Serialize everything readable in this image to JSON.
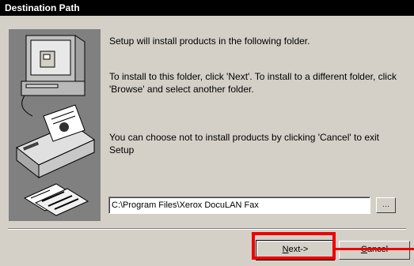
{
  "window": {
    "title": "Destination Path"
  },
  "messages": {
    "line1": "Setup will install products in the following folder.",
    "line2": "To install to this folder, click 'Next'. To install to a different folder, click 'Browse' and select another folder.",
    "line3": "You can choose not to install products by clicking 'Cancel' to exit Setup"
  },
  "destination": {
    "path": "C:\\Program Files\\Xerox DocuLAN Fax",
    "browse_label": "..."
  },
  "buttons": {
    "next_prefix": "N",
    "next_rest": "ext->",
    "cancel_prefix": "C",
    "cancel_rest": "ancel"
  },
  "annotation": {
    "highlight_color": "#ee0000"
  },
  "icons": [
    "computer-icon",
    "printer-icon",
    "documents-icon"
  ]
}
